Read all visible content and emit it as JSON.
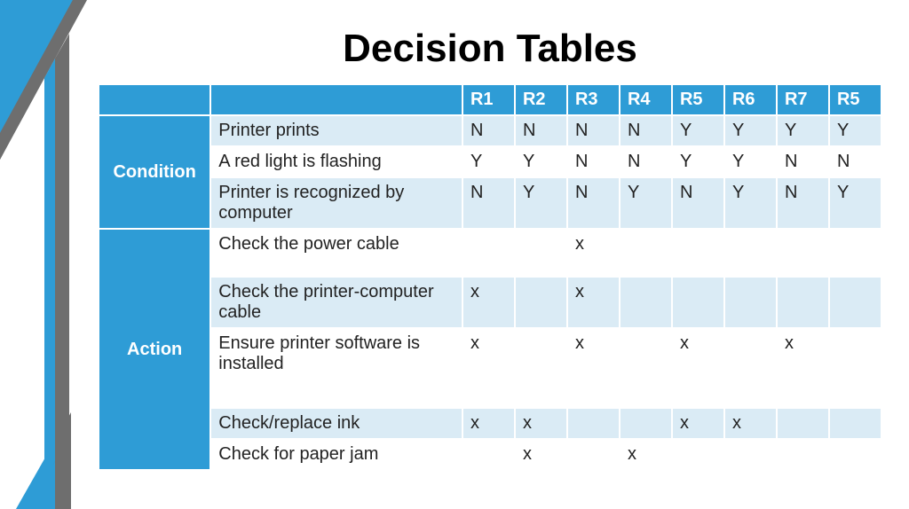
{
  "title": "Decision Tables",
  "rules": [
    "R1",
    "R2",
    "R3",
    "R4",
    "R5",
    "R6",
    "R7",
    "R5"
  ],
  "sections": {
    "condition": "Condition",
    "action": "Action"
  },
  "conditions": [
    {
      "label": "Printer prints",
      "values": [
        "N",
        "N",
        "N",
        "N",
        "Y",
        "Y",
        "Y",
        "Y"
      ]
    },
    {
      "label": "A red light is flashing",
      "values": [
        "Y",
        "Y",
        "N",
        "N",
        "Y",
        "Y",
        "N",
        "N"
      ]
    },
    {
      "label": "Printer is recognized by computer",
      "values": [
        "N",
        "Y",
        "N",
        "Y",
        "N",
        "Y",
        "N",
        "Y"
      ]
    }
  ],
  "actions": [
    {
      "label": "Check the power cable",
      "values": [
        "",
        "",
        "x",
        "",
        "",
        "",
        "",
        ""
      ]
    },
    {
      "label": "Check the printer-computer cable",
      "values": [
        "x",
        "",
        "x",
        "",
        "",
        "",
        "",
        ""
      ]
    },
    {
      "label": "Ensure printer software is installed",
      "values": [
        "x",
        "",
        "x",
        "",
        "x",
        "",
        "x",
        ""
      ]
    },
    {
      "label": "Check/replace ink",
      "values": [
        "x",
        "x",
        "",
        "",
        "x",
        "x",
        "",
        ""
      ]
    },
    {
      "label": "Check for paper jam",
      "values": [
        "",
        "x",
        "",
        "x",
        "",
        "",
        "",
        ""
      ]
    }
  ]
}
